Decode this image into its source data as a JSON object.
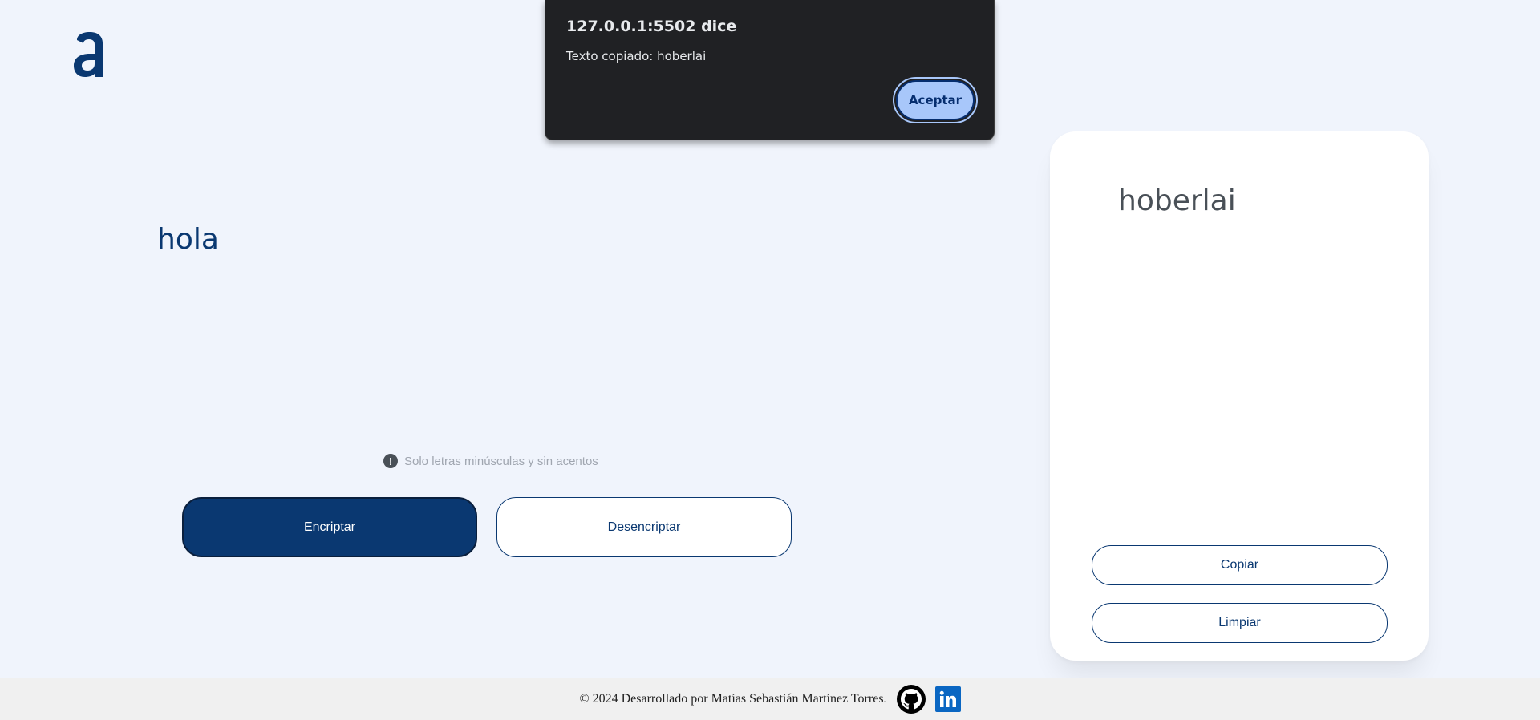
{
  "app": {
    "logo_icon": "alura-a-logo-icon",
    "logo_glyph": "a",
    "brand_color": "#0a3871"
  },
  "input": {
    "value": "hola"
  },
  "hint": {
    "icon": "exclamation-circle-icon",
    "icon_glyph": "!",
    "text": "Solo letras minúsculas y sin acentos"
  },
  "buttons": {
    "encrypt_label": "Encriptar",
    "decrypt_label": "Desencriptar"
  },
  "output": {
    "text": "hoberlai",
    "copy_label": "Copiar",
    "clear_label": "Limpiar"
  },
  "footer": {
    "text": "© 2024 Desarrollado por Matías Sebastián Martínez Torres.",
    "github_icon": "github-icon",
    "linkedin_icon": "linkedin-icon",
    "linkedin_glyph": "in"
  },
  "dialog": {
    "title": "127.0.0.1:5502 dice",
    "message": "Texto copiado: hoberlai",
    "accept_label": "Aceptar",
    "accent_color": "#a8c7fa"
  }
}
